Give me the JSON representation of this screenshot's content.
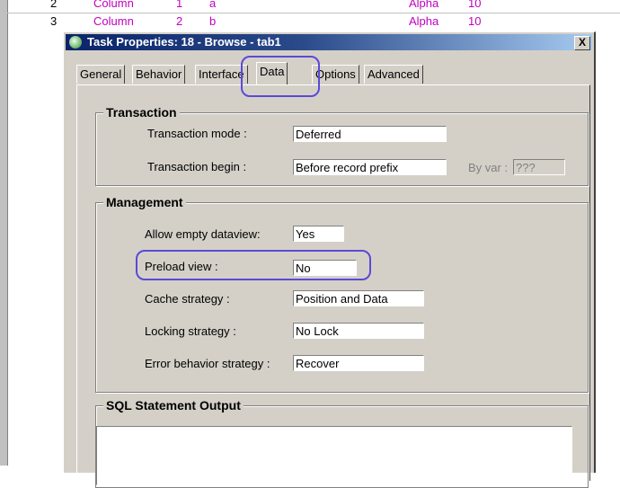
{
  "background_rows": [
    {
      "num": "2",
      "name": "Column",
      "n": "1",
      "letter": "a",
      "type": "Alpha",
      "size": "10"
    },
    {
      "num": "3",
      "name": "Column",
      "n": "2",
      "letter": "b",
      "type": "Alpha",
      "size": "10"
    }
  ],
  "dialog": {
    "title": "Task Properties: 18 -  Browse - tab1",
    "close_label": "X"
  },
  "tabs": [
    "General",
    "Behavior",
    "Interface",
    "Data",
    "Options",
    "Advanced"
  ],
  "active_tab": "Data",
  "transaction": {
    "title": "Transaction",
    "mode_label": "Transaction mode :",
    "mode_value": "Deferred",
    "begin_label": "Transaction begin :",
    "begin_value": "Before record prefix",
    "byvar_label": "By var :",
    "byvar_value": "???"
  },
  "management": {
    "title": "Management",
    "allow_empty_label": "Allow empty dataview:",
    "allow_empty_value": "Yes",
    "preload_label": "Preload view :",
    "preload_value": "No",
    "cache_label": "Cache strategy :",
    "cache_value": "Position and Data",
    "locking_label": "Locking strategy :",
    "locking_value": "No Lock",
    "error_label": "Error behavior strategy :",
    "error_value": "Recover"
  },
  "sql": {
    "title": "SQL Statement Output"
  },
  "colors": {
    "title_start": "#0a246a",
    "title_end": "#a6caf0",
    "face": "#d4d0c8",
    "highlight": "#5a4ad6",
    "grid_text": "#c000c0"
  }
}
